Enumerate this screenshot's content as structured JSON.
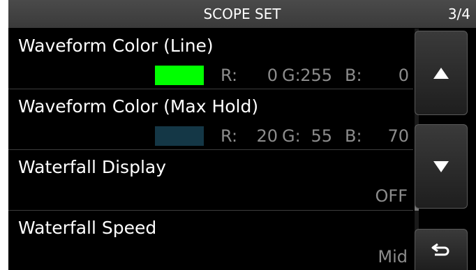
{
  "header": {
    "title": "SCOPE SET",
    "page": "3/4"
  },
  "items": [
    {
      "label": "Waveform Color (Line)",
      "swatch_color": "#00ff00",
      "r_label": "R:",
      "r_value": "0",
      "g_label": "G:",
      "g_value": "255",
      "b_label": "B:",
      "b_value": "0"
    },
    {
      "label": "Waveform Color (Max Hold)",
      "swatch_color": "#143746",
      "r_label": "R:",
      "r_value": "20",
      "g_label": "G:",
      "g_value": "55",
      "b_label": "B:",
      "b_value": "70"
    },
    {
      "label": "Waterfall Display",
      "value": "OFF"
    },
    {
      "label": "Waterfall Speed",
      "value": "Mid"
    }
  ],
  "buttons": {
    "up_icon": "triangle-up-icon",
    "down_icon": "triangle-down-icon",
    "back_icon": "return-arrow-icon"
  },
  "colors": {
    "background": "#000000",
    "text": "#ffffff",
    "value_text": "#8c8c8c",
    "titlebar": "#404040"
  }
}
